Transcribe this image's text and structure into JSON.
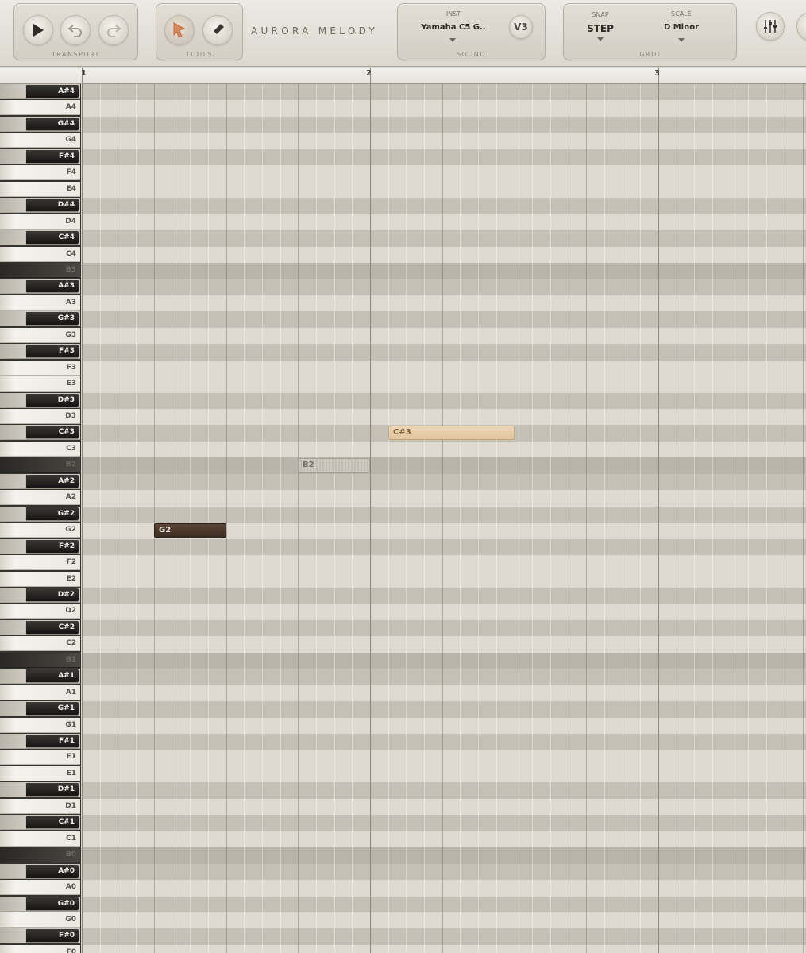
{
  "app": {
    "title": "AURORA MELODY"
  },
  "transport": {
    "label": "TRANSPORT",
    "buttons": [
      {
        "icon": "play-icon"
      },
      {
        "icon": "undo-icon"
      },
      {
        "icon": "redo-icon"
      }
    ]
  },
  "tools": {
    "label": "TOOLS",
    "buttons": [
      {
        "icon": "select-tool-icon",
        "color": "#d88a5a"
      },
      {
        "icon": "pencil-icon"
      }
    ]
  },
  "sound": {
    "label": "SOUND",
    "inst_label": "INST",
    "instrument": "Yamaha C5 G..",
    "version": "V3"
  },
  "grid_panel": {
    "label": "GRID",
    "snap_label": "SNAP",
    "snap_value": "STEP",
    "scale_label": "SCALE",
    "scale_value": "D Minor"
  },
  "extra_buttons": [
    {
      "icon": "mixer-icon"
    }
  ],
  "ruler": {
    "bars": [
      "1",
      "2",
      "3"
    ]
  },
  "keys": [
    {
      "n": "A#4",
      "b": true
    },
    {
      "n": "A4",
      "b": false
    },
    {
      "n": "G#4",
      "b": true
    },
    {
      "n": "G4",
      "b": false
    },
    {
      "n": "F#4",
      "b": true
    },
    {
      "n": "F4",
      "b": false
    },
    {
      "n": "E4",
      "b": false
    },
    {
      "n": "D#4",
      "b": true
    },
    {
      "n": "D4",
      "b": false
    },
    {
      "n": "C#4",
      "b": true
    },
    {
      "n": "C4",
      "b": false
    },
    {
      "n": "B3",
      "b": false,
      "d": true
    },
    {
      "n": "A#3",
      "b": true
    },
    {
      "n": "A3",
      "b": false
    },
    {
      "n": "G#3",
      "b": true
    },
    {
      "n": "G3",
      "b": false
    },
    {
      "n": "F#3",
      "b": true
    },
    {
      "n": "F3",
      "b": false
    },
    {
      "n": "E3",
      "b": false
    },
    {
      "n": "D#3",
      "b": true
    },
    {
      "n": "D3",
      "b": false
    },
    {
      "n": "C#3",
      "b": true
    },
    {
      "n": "C3",
      "b": false
    },
    {
      "n": "B2",
      "b": false,
      "d": true
    },
    {
      "n": "A#2",
      "b": true
    },
    {
      "n": "A2",
      "b": false
    },
    {
      "n": "G#2",
      "b": true
    },
    {
      "n": "G2",
      "b": false
    },
    {
      "n": "F#2",
      "b": true
    },
    {
      "n": "F2",
      "b": false
    },
    {
      "n": "E2",
      "b": false
    },
    {
      "n": "D#2",
      "b": true
    },
    {
      "n": "D2",
      "b": false
    },
    {
      "n": "C#2",
      "b": true
    },
    {
      "n": "C2",
      "b": false
    },
    {
      "n": "B1",
      "b": false,
      "d": true
    },
    {
      "n": "A#1",
      "b": true
    },
    {
      "n": "A1",
      "b": false
    },
    {
      "n": "G#1",
      "b": true
    },
    {
      "n": "G1",
      "b": false
    },
    {
      "n": "F#1",
      "b": true
    },
    {
      "n": "F1",
      "b": false
    },
    {
      "n": "E1",
      "b": false
    },
    {
      "n": "D#1",
      "b": true
    },
    {
      "n": "D1",
      "b": false
    },
    {
      "n": "C#1",
      "b": true
    },
    {
      "n": "C1",
      "b": false
    },
    {
      "n": "B0",
      "b": false,
      "d": true
    },
    {
      "n": "A#0",
      "b": true
    },
    {
      "n": "A0",
      "b": false
    },
    {
      "n": "G#0",
      "b": true
    },
    {
      "n": "G0",
      "b": false
    },
    {
      "n": "F#0",
      "b": true
    },
    {
      "n": "F0",
      "b": false
    }
  ],
  "notes": [
    {
      "pitch": "C#3",
      "label": "C#3",
      "bar": 2.0625,
      "length": 0.4375,
      "style": "light"
    },
    {
      "pitch": "B2",
      "label": "B2",
      "bar": 1.75,
      "length": 0.25,
      "style": "ghost"
    },
    {
      "pitch": "G2",
      "label": "G2",
      "bar": 1.25,
      "length": 0.25,
      "style": "dark"
    }
  ]
}
